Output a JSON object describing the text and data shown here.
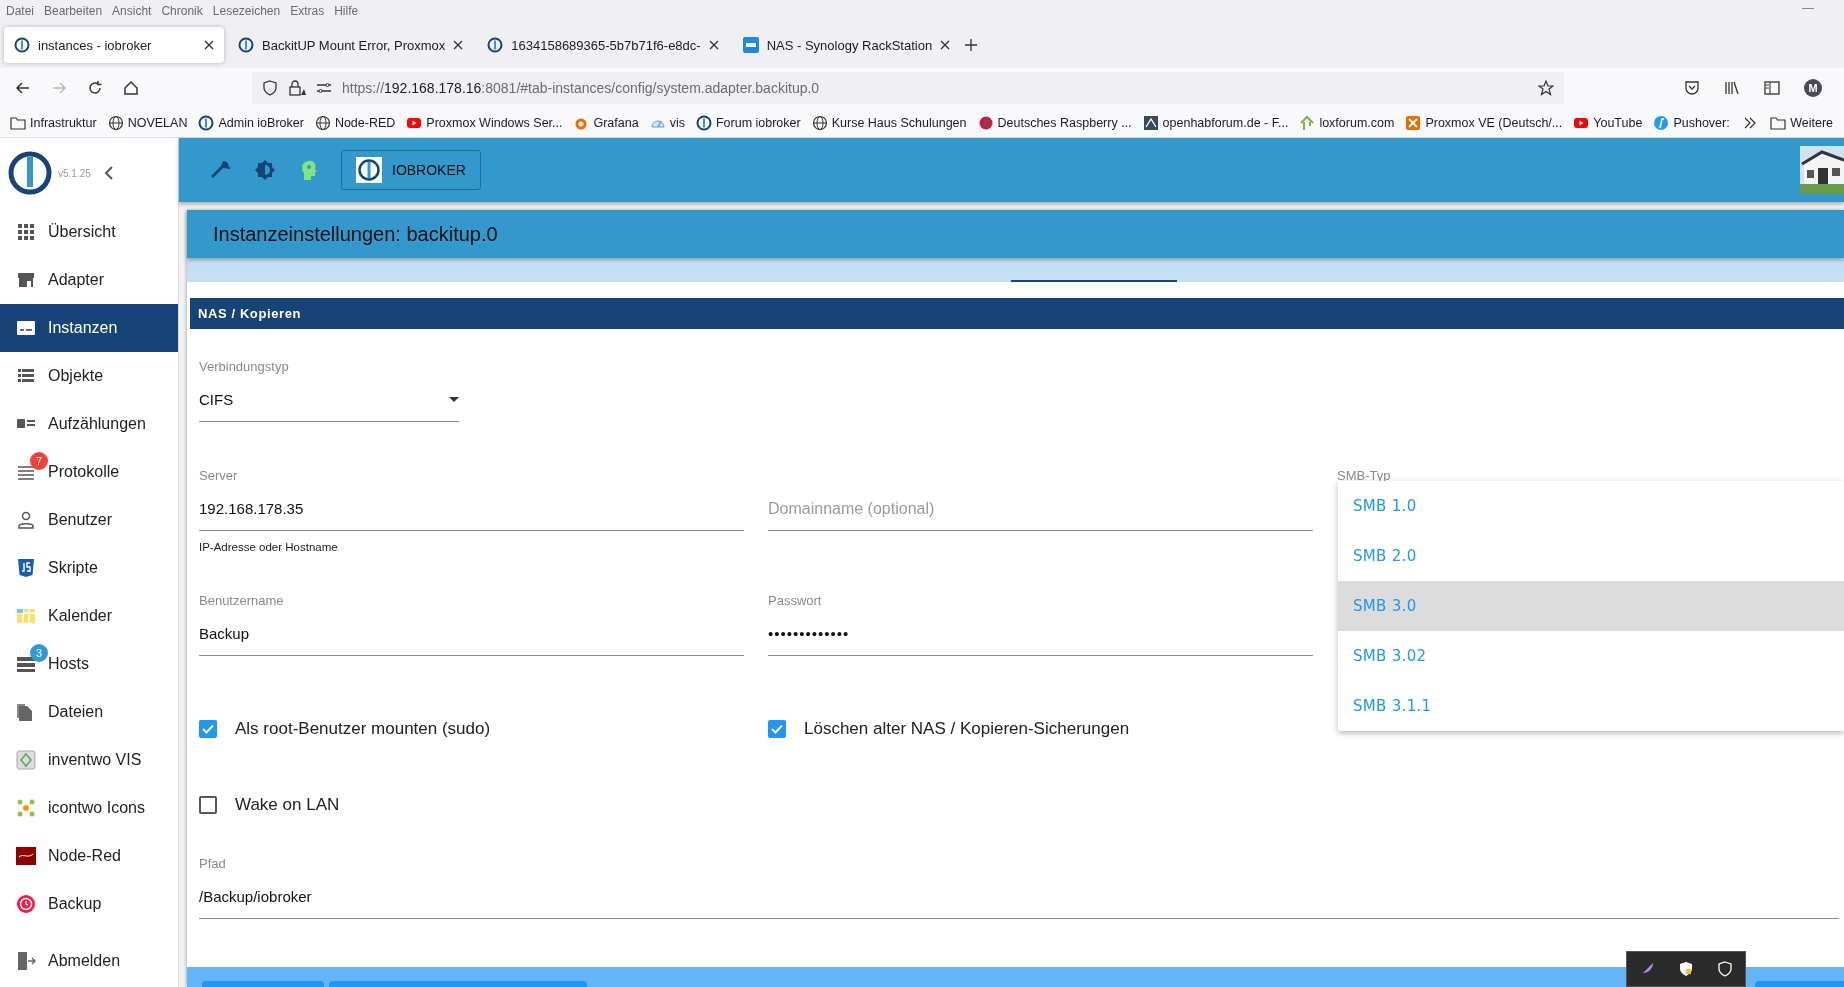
{
  "browser": {
    "menu": [
      "Datei",
      "Bearbeiten",
      "Ansicht",
      "Chronik",
      "Lesezeichen",
      "Extras",
      "Hilfe"
    ],
    "tabs": [
      {
        "title": "instances - iobroker",
        "selected": true
      },
      {
        "title": "BackitUP Mount Error, Proxmox",
        "selected": false
      },
      {
        "title": "1634158689365-5b7b71f6-e8dc-",
        "selected": false
      },
      {
        "title": "NAS - Synology RackStation",
        "selected": false
      }
    ],
    "address": {
      "scheme": "https://",
      "host": "192.168.178.16",
      "rest": ":8081/#tab-instances/config/system.adapter.backitup.0"
    },
    "avatar": "M",
    "bookmarks": [
      "Infrastruktur",
      "NOVELAN",
      "Admin ioBroker",
      "Node-RED",
      "Proxmox Windows Ser...",
      "Grafana",
      "vis",
      "Forum iobroker",
      "Kurse Haus Schulungen",
      "Deutsches Raspberry ...",
      "openhabforum.de - F...",
      "loxforum.com",
      "Proxmox VE (Deutsch/...",
      "YouTube",
      "Pushover:"
    ],
    "bookmarks_more": "Weitere"
  },
  "app": {
    "version": "v5.1.25",
    "sidebar": [
      {
        "label": "Übersicht",
        "selected": false
      },
      {
        "label": "Adapter",
        "selected": false
      },
      {
        "label": "Instanzen",
        "selected": true
      },
      {
        "label": "Objekte",
        "selected": false
      },
      {
        "label": "Aufzählungen",
        "selected": false
      },
      {
        "label": "Protokolle",
        "selected": false,
        "badge": "7",
        "color": "#f44336"
      },
      {
        "label": "Benutzer",
        "selected": false
      },
      {
        "label": "Skripte",
        "selected": false
      },
      {
        "label": "Kalender",
        "selected": false
      },
      {
        "label": "Hosts",
        "selected": false,
        "badge": "3",
        "color": "#2e9bd6"
      },
      {
        "label": "Dateien",
        "selected": false
      },
      {
        "label": "inventwo VIS",
        "selected": false
      },
      {
        "label": "icontwo Icons",
        "selected": false
      },
      {
        "label": "Node-Red",
        "selected": false
      },
      {
        "label": "Backup",
        "selected": false
      }
    ],
    "logout": "Abmelden",
    "host_button": "IOBROKER"
  },
  "dialog": {
    "title": "Instanzeinstellungen: backitup.0",
    "section": "NAS / Kopieren",
    "connection": {
      "label": "Verbindungstyp",
      "value": "CIFS"
    },
    "server": {
      "label": "Server",
      "value": "192.168.178.35",
      "helper": "IP-Adresse oder Hostname"
    },
    "domain": {
      "placeholder": "Domainname (optional)"
    },
    "smb_label": "SMB-Typ",
    "user": {
      "label": "Benutzername",
      "value": "Backup"
    },
    "password": {
      "label": "Passwort",
      "value": "•••••••••••••"
    },
    "checkboxes": [
      {
        "label": "Als root-Benutzer mounten (sudo)",
        "checked": true
      },
      {
        "label": "Löschen alter NAS / Kopieren-Sicherungen",
        "checked": true
      },
      {
        "label": "Wake on LAN",
        "checked": false
      }
    ],
    "path": {
      "label": "Pfad",
      "value": "/Backup/iobroker"
    },
    "smb_options": [
      {
        "label": "SMB 1.0",
        "selected": false
      },
      {
        "label": "SMB 2.0",
        "selected": false
      },
      {
        "label": "SMB 3.0",
        "selected": true
      },
      {
        "label": "SMB 3.02",
        "selected": false
      },
      {
        "label": "SMB 3.1.1",
        "selected": false
      }
    ]
  }
}
